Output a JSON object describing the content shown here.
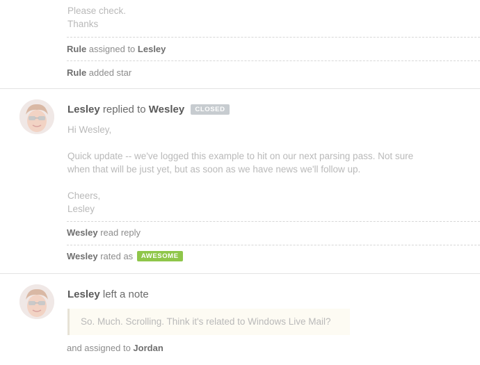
{
  "top_message": {
    "lines": [
      "Please check.",
      "Thanks"
    ],
    "events": [
      {
        "actor": "Rule",
        "action": "assigned to",
        "target": "Lesley"
      },
      {
        "actor": "Rule",
        "action": "added star"
      }
    ]
  },
  "reply": {
    "author": "Lesley",
    "verb": "replied to",
    "recipient": "Wesley",
    "status_badge": "CLOSED",
    "greeting": "Hi Wesley,",
    "body_line1": "Quick update -- we've logged this example to hit on our next parsing pass. Not sure",
    "body_line2": "when that will be just yet, but as soon as we have news we'll follow up.",
    "signoff": "Cheers,",
    "signature": "Lesley",
    "events": [
      {
        "actor": "Wesley",
        "action": "read reply"
      },
      {
        "actor": "Wesley",
        "action": "rated as",
        "badge": "AWESOME"
      }
    ]
  },
  "note": {
    "author": "Lesley",
    "verb": "left a note",
    "text": "So. Much. Scrolling. Think it's related to Windows Live Mail?",
    "assign_text": "and assigned to",
    "assignee": "Jordan"
  },
  "colors": {
    "closed_badge": "#c7ccd0",
    "awesome_badge": "#8fc64a",
    "note_background": "#fdfbf3"
  },
  "icons": {
    "avatar": "lesley-avatar"
  }
}
